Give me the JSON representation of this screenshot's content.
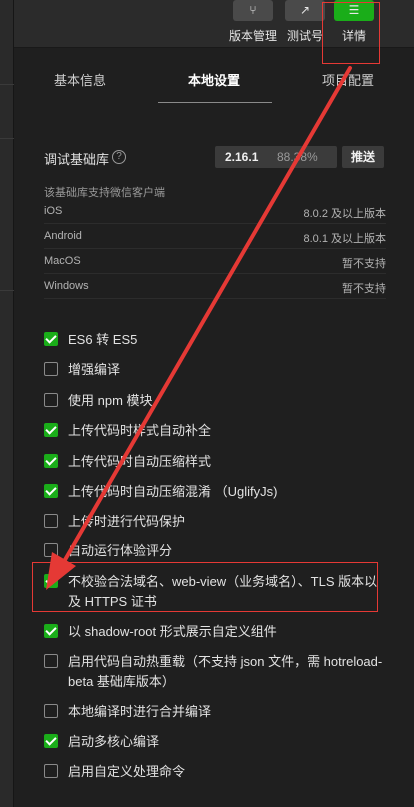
{
  "toolbar": {
    "items": [
      {
        "label": "版本管理",
        "icon": "branch-icon",
        "glyph": "⑂"
      },
      {
        "label": "测试号",
        "icon": "external-link-icon",
        "glyph": "↗"
      },
      {
        "label": "详情",
        "icon": "menu-icon",
        "glyph": "☰"
      }
    ]
  },
  "tabs": [
    "基本信息",
    "本地设置",
    "项目配置"
  ],
  "library": {
    "label": "调试基础库",
    "help_glyph": "?",
    "version": "2.16.1",
    "percent": "88.38%",
    "push_label": "推送"
  },
  "support": {
    "title": "该基础库支持微信客户端",
    "rows": [
      {
        "os": "iOS",
        "status": "8.0.2 及以上版本"
      },
      {
        "os": "Android",
        "status": "8.0.1 及以上版本"
      },
      {
        "os": "MacOS",
        "status": "暂不支持"
      },
      {
        "os": "Windows",
        "status": "暂不支持"
      }
    ]
  },
  "options": [
    {
      "label": "ES6 转 ES5",
      "checked": true
    },
    {
      "label": "增强编译",
      "checked": false
    },
    {
      "label": "使用 npm 模块",
      "checked": false
    },
    {
      "label": "上传代码时样式自动补全",
      "checked": true
    },
    {
      "label": "上传代码时自动压缩样式",
      "checked": true
    },
    {
      "label": "上传代码时自动压缩混淆 （UglifyJs)",
      "checked": true
    },
    {
      "label": "上传时进行代码保护",
      "checked": false
    },
    {
      "label": "自动运行体验评分",
      "checked": false
    },
    {
      "label": "不校验合法域名、web-view（业务域名）、TLS 版本以及 HTTPS 证书",
      "checked": true
    },
    {
      "label": "以 shadow-root 形式展示自定义组件",
      "checked": true
    },
    {
      "label": "启用代码自动热重载（不支持 json 文件，需 hotreload-beta 基础库版本）",
      "checked": false
    },
    {
      "label": "本地编译时进行合并编译",
      "checked": false
    },
    {
      "label": "启动多核心编译",
      "checked": true
    },
    {
      "label": "启用自定义处理命令",
      "checked": false
    }
  ],
  "colors": {
    "accent": "#1aad19",
    "annotation": "#e53935"
  }
}
